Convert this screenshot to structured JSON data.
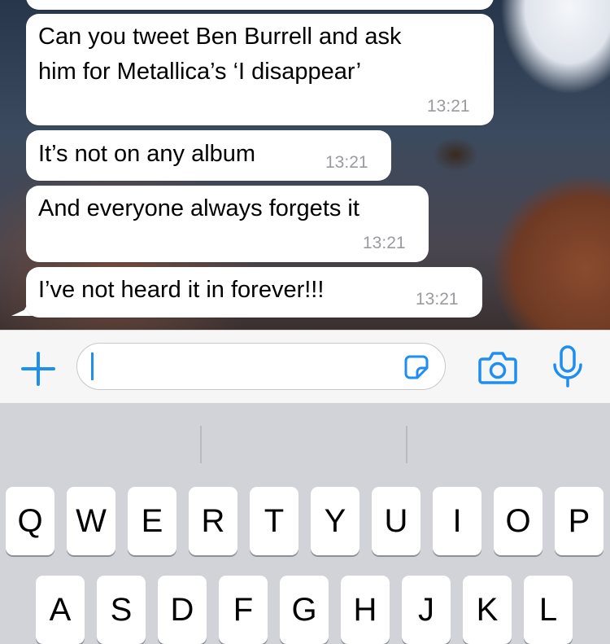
{
  "messages": [
    {
      "text": "Can you tweet Ben Burrell and ask\nhim for Metallica’s ‘I disappear’",
      "time": "13:21"
    },
    {
      "text": "It’s not on any album",
      "time": "13:21"
    },
    {
      "text": "And everyone always forgets it",
      "time": "13:21"
    },
    {
      "text": "I’ve not heard it in forever!!!",
      "time": "13:21"
    }
  ],
  "input": {
    "value": "",
    "placeholder": ""
  },
  "icons": {
    "attach": "plus-icon",
    "sticker": "sticker-icon",
    "camera": "camera-icon",
    "microphone": "microphone-icon"
  },
  "colors": {
    "accent": "#1f8ef1",
    "bubble": "#ffffff",
    "timestamp": "#9a9a9f"
  },
  "keyboard": {
    "row1": [
      "Q",
      "W",
      "E",
      "R",
      "T",
      "Y",
      "U",
      "I",
      "O",
      "P"
    ],
    "row2": [
      "A",
      "S",
      "D",
      "F",
      "G",
      "H",
      "J",
      "K",
      "L"
    ]
  }
}
